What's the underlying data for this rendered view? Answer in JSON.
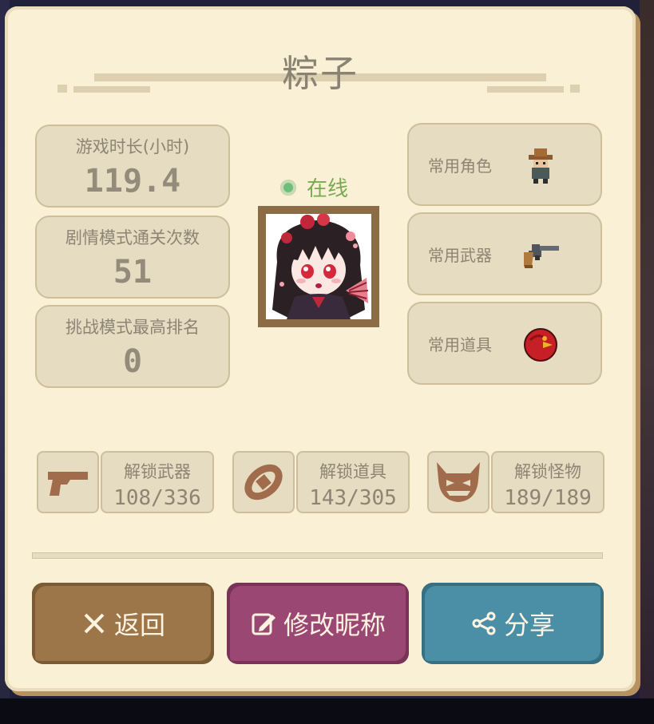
{
  "player": {
    "name": "粽子",
    "status": "在线"
  },
  "stats": [
    {
      "label": "游戏时长(小时)",
      "value": "119.4"
    },
    {
      "label": "剧情模式通关次数",
      "value": "51"
    },
    {
      "label": "挑战模式最高排名",
      "value": "0"
    }
  ],
  "favorites": [
    {
      "label": "常用角色",
      "icon": "cowboy-character-icon"
    },
    {
      "label": "常用武器",
      "icon": "revolver-icon"
    },
    {
      "label": "常用道具",
      "icon": "red-bird-item-icon"
    }
  ],
  "unlocks": [
    {
      "label": "解锁武器",
      "count": "108/336",
      "icon": "pistol-icon"
    },
    {
      "label": "解锁道具",
      "count": "143/305",
      "icon": "ring-item-icon"
    },
    {
      "label": "解锁怪物",
      "count": "189/189",
      "icon": "demon-face-icon"
    }
  ],
  "buttons": {
    "back": "返回",
    "edit_nickname": "修改昵称",
    "share": "分享"
  },
  "colors": {
    "panel": "#faf0d6",
    "back_button": "#9c7548",
    "edit_button": "#9a4773",
    "share_button": "#4b8fa6",
    "online": "#79a953"
  }
}
